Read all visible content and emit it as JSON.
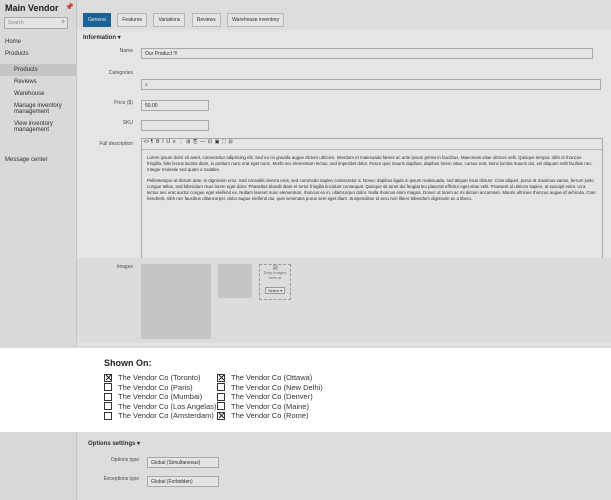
{
  "sidebar": {
    "brand": "Main Vendor",
    "search_placeholder": "Search",
    "items": [
      {
        "label": "Home"
      },
      {
        "label": "Products"
      },
      {
        "label": "Products"
      },
      {
        "label": "Reviews"
      },
      {
        "label": "Warehouse"
      },
      {
        "label": "Manage inventory management"
      },
      {
        "label": "View inventory management"
      },
      {
        "label": "Message center"
      }
    ]
  },
  "tabs": [
    "General",
    "Features",
    "Variations",
    "Reviews",
    "Warehouse inventory"
  ],
  "information": {
    "title": "Information",
    "name_label": "Name",
    "name_value": "Our Product !!!",
    "category_label": "Categories",
    "price_label": "Price ($)",
    "price_value": "50.00",
    "sku_label": "SKU",
    "desc_label": "Full description",
    "desc_p1": "Lorem ipsum dolor sit amet, consectetur adipiscing elit. Sed eu mi gravida augue dictum ultricies. Interdum et malesuada fames ac ante ipsum primis in faucibus. Maecenas vitae ultrices velit. Quisque tempor, nibh id rhoncus fringilla, felis lectus lacinia diam, in pretium nunc erat eget nunc. Morbi nec elementum lectus, sed imperdiet dolor. Fusce quis mauris dapibus, dapibus lorem vitae, cursus erat. Nunc lacinia mauris dui, vel aliquam velit facilisis nec. Integer molestie sed quam a sodales.",
    "desc_p2": "Pellentesque at dictum ante, in dignissim eros. Sed convallis viverra eros, sed commodo sapien consectetur a. Donec dapibus ligula in ipsum malesuada, sed aliquet risus dictum. Cras aliquet, purus at maximus varius, ferrum justo congue tellus, sed bibendum risus lorem eget dolor. Phasellus blandit diam et tortor fringilla tincidunt consequat. Quisque sit amet dui feugiat leo placerat efficitur eget vitae velit. Praesent id ultrices sapien, at suscipit enim. Ut a lectus nec erat auctor congue eget eleifend ex. Nullam laoreet nunc elementum, rhoncus ex in, ullamcorper dolor. Nulla rhoncus enim magna. Donec ut lorem ac mi dictum accumsan. Mauris ultricies rhoncus augue id vehicula. Cras hendrerit, nibh nec faucibus ullamcorper, dolor augue eleifend dui, quis venenatis purus sem eget diam. Suspendisse id arcu non libero bibendum dignissim ac a libero.",
    "images_label": "Images",
    "drop_text": "Drop images here or",
    "select_label": "Select"
  },
  "shown_on": {
    "title": "Shown On:",
    "left": [
      {
        "label": "The Vendor Co (Toronto)",
        "checked": true
      },
      {
        "label": "The Vendor Co (Paris)",
        "checked": false
      },
      {
        "label": "The Vendor Co (Mumbai)",
        "checked": false
      },
      {
        "label": "The Vendor Co (Los Angelas)",
        "checked": false
      },
      {
        "label": "The Vendor Co (Amsterdam)",
        "checked": false
      }
    ],
    "right": [
      {
        "label": "The Vendor Co (Ottawa)",
        "checked": true
      },
      {
        "label": "The Vendor Co (New Delhi)",
        "checked": false
      },
      {
        "label": "The Vendor Co (Denver)",
        "checked": false
      },
      {
        "label": "The Vendor Co (Maine)",
        "checked": false
      },
      {
        "label": "The Vendor Co (Rome)",
        "checked": true
      }
    ]
  },
  "options": {
    "title": "Options settings",
    "type_label": "Options type",
    "type_value": "Global (Simultaneous)",
    "exceptions_label": "Exceptions type",
    "exceptions_value": "Global (Forbidden)"
  }
}
